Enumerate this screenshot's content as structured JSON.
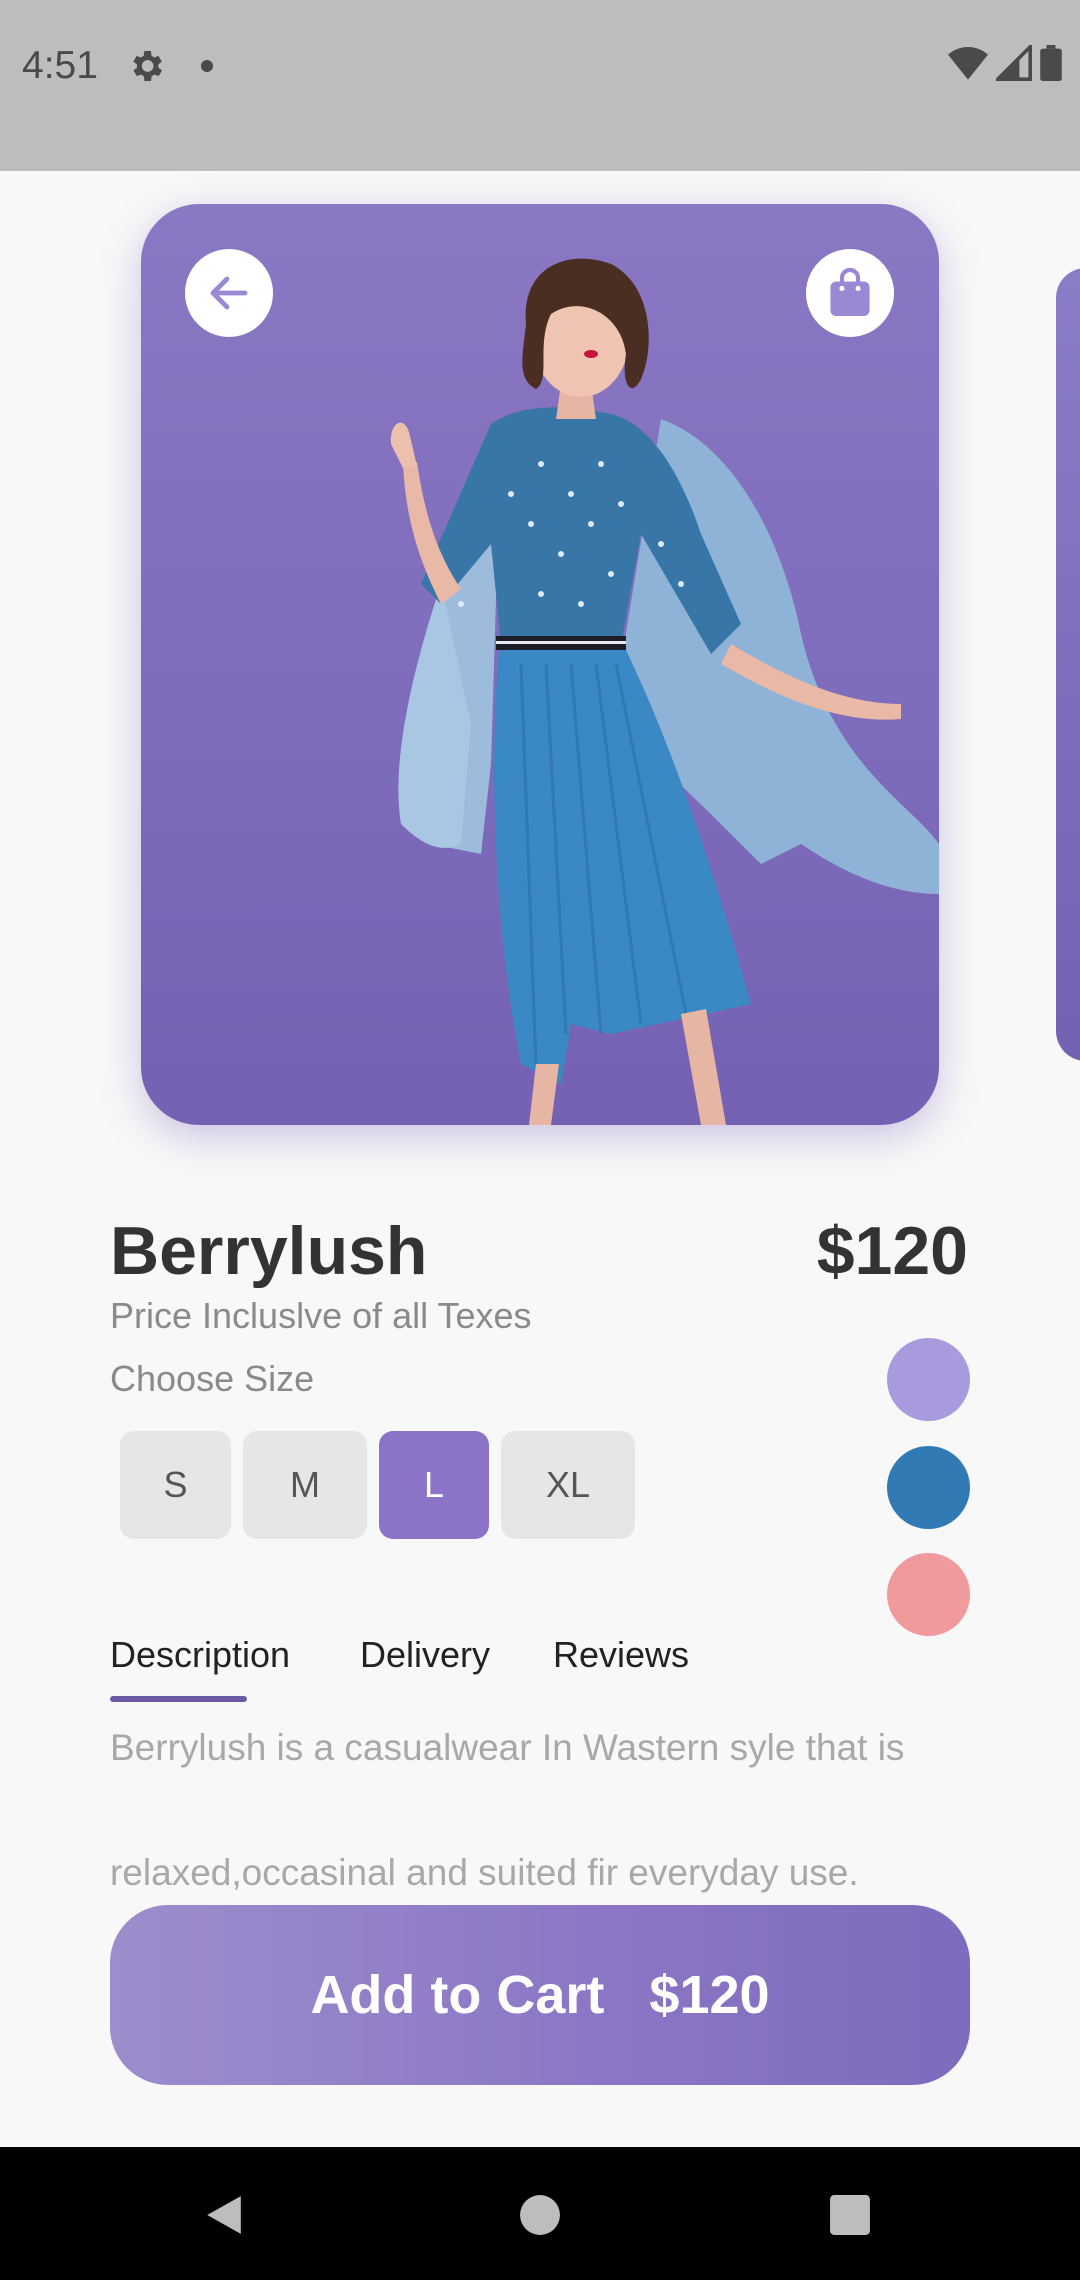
{
  "status_bar": {
    "time": "4:51"
  },
  "product": {
    "name": "Berrylush",
    "price": "$120",
    "price_note": "Price Incluslve of all Texes",
    "choose_size_label": "Choose Size",
    "sizes": [
      "S",
      "M",
      "L",
      "XL"
    ],
    "selected_size": "L",
    "colors": [
      "#a99ade",
      "#327ab3",
      "#f09a9d"
    ]
  },
  "tabs": [
    "Description",
    "Delivery",
    "Reviews"
  ],
  "active_tab": "Description",
  "description": {
    "line1": "Berrylush is a casualwear In Wastern syle that is",
    "line2": "relaxed,occasinal and suited fir everyday use."
  },
  "cart_button": {
    "label": "Add to Cart",
    "price": "$120"
  },
  "icons": {
    "back": "arrow-left-icon",
    "bag": "shopping-bag-icon"
  }
}
